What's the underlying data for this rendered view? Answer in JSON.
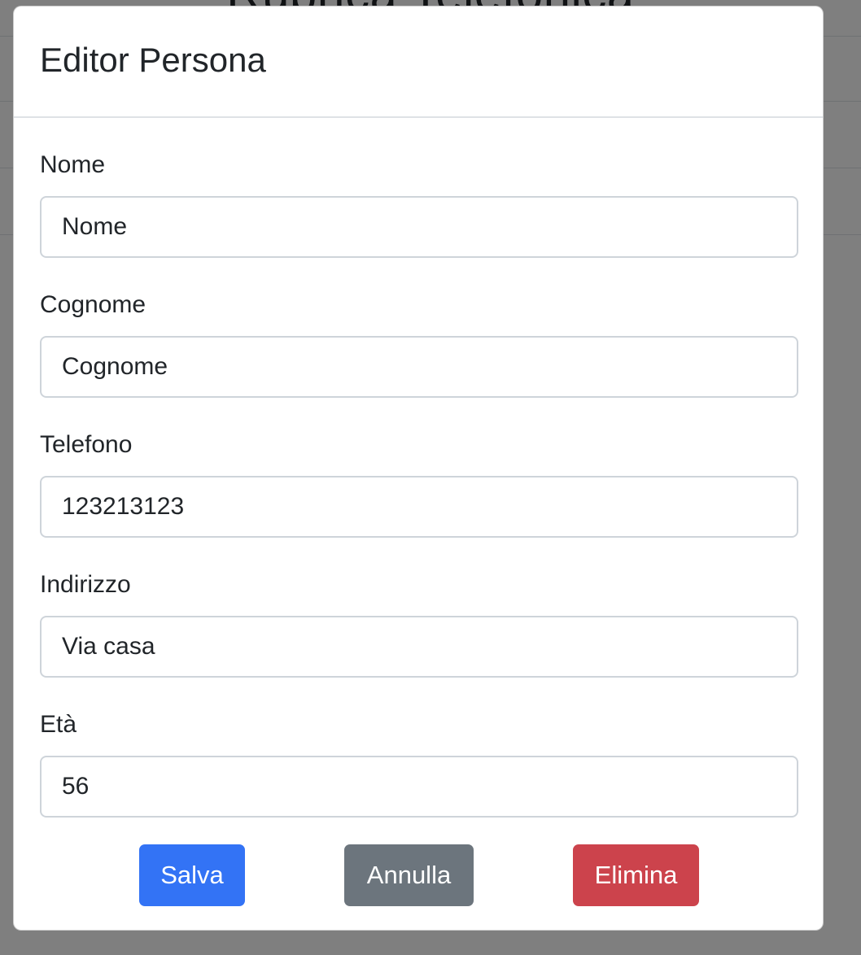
{
  "background_page": {
    "title": "Rubrica Telefonica"
  },
  "modal": {
    "title": "Editor Persona",
    "fields": [
      {
        "label": "Nome",
        "value": "Nome"
      },
      {
        "label": "Cognome",
        "value": "Cognome"
      },
      {
        "label": "Telefono",
        "value": "123213123"
      },
      {
        "label": "Indirizzo",
        "value": "Via casa"
      },
      {
        "label": "Età",
        "value": "56"
      }
    ],
    "buttons": {
      "save": "Salva",
      "cancel": "Annulla",
      "delete": "Elimina"
    }
  },
  "colors": {
    "primary": "#3373f5",
    "secondary": "#6c757d",
    "danger": "#cc434c",
    "backdrop": "#404040"
  }
}
